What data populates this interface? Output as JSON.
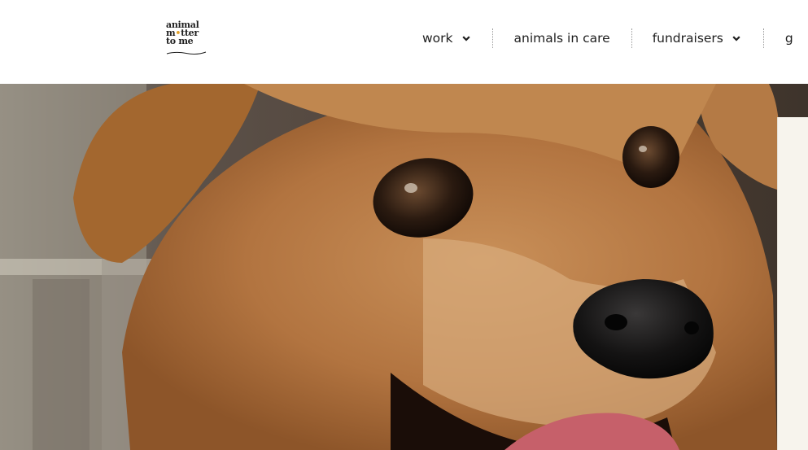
{
  "logo": {
    "lines": [
      "animal",
      "m",
      "tter",
      "to me"
    ],
    "dot_char": "•"
  },
  "nav": {
    "items": [
      {
        "label": "work",
        "has_dropdown": true
      },
      {
        "label": "animals in care",
        "has_dropdown": false
      },
      {
        "label": "fundraisers",
        "has_dropdown": true
      },
      {
        "label": "g",
        "has_dropdown": false
      }
    ]
  },
  "hero": {
    "subject": "dog"
  },
  "colors": {
    "accent": "#e5a32b",
    "text": "#1e1e1e",
    "background": "#ffffff",
    "card": "#f7f4ed"
  }
}
